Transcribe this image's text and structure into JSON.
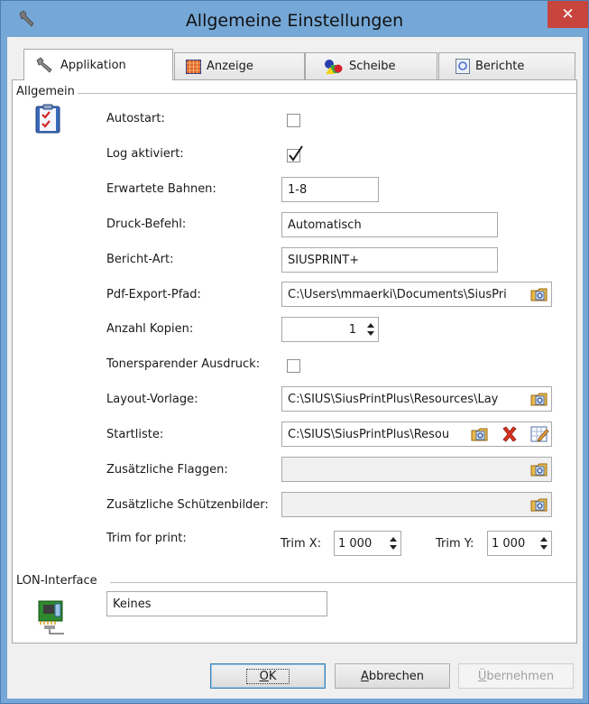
{
  "window": {
    "title": "Allgemeine Einstellungen",
    "close_label": "✕"
  },
  "tabs": [
    {
      "label": "Applikation",
      "icon": "wrench-icon"
    },
    {
      "label": "Anzeige",
      "icon": "grid-icon"
    },
    {
      "label": "Scheibe",
      "icon": "shapes-icon"
    },
    {
      "label": "Berichte",
      "icon": "report-icon"
    }
  ],
  "groups": {
    "general": "Allgemein",
    "lon": "LON-Interface"
  },
  "fields": {
    "autostart": {
      "label": "Autostart:",
      "checked": false
    },
    "log": {
      "label": "Log aktiviert:",
      "checked": true
    },
    "bahnen": {
      "label": "Erwartete Bahnen:",
      "value": "1-8"
    },
    "druck": {
      "label": "Druck-Befehl:",
      "value": "Automatisch"
    },
    "bericht": {
      "label": "Bericht-Art:",
      "value": "SIUSPRINT+"
    },
    "pdf": {
      "label": "Pdf-Export-Pfad:",
      "value": "C:\\Users\\mmaerki\\Documents\\SiusPri"
    },
    "kopien": {
      "label": "Anzahl Kopien:",
      "value": "1"
    },
    "toner": {
      "label": "Tonersparender Ausdruck:",
      "checked": false
    },
    "layout": {
      "label": "Layout-Vorlage:",
      "value": "C:\\SIUS\\SiusPrintPlus\\Resources\\Lay"
    },
    "startliste": {
      "label": "Startliste:",
      "value": "C:\\SIUS\\SiusPrintPlus\\Resou"
    },
    "flaggen": {
      "label": "Zusätzliche Flaggen:",
      "value": ""
    },
    "schuetzen": {
      "label": "Zusätzliche Schützenbilder:",
      "value": ""
    },
    "trim": {
      "label": "Trim for print:",
      "x_label": "Trim X:",
      "x_value": "1 000",
      "y_label": "Trim Y:",
      "y_value": "1 000"
    },
    "lon": {
      "value": "Keines"
    }
  },
  "buttons": {
    "ok": {
      "accel": "O",
      "rest": "K"
    },
    "cancel": {
      "accel": "A",
      "rest": "bbrechen"
    },
    "apply": {
      "accel": "Ü",
      "rest": "bernehmen"
    }
  }
}
